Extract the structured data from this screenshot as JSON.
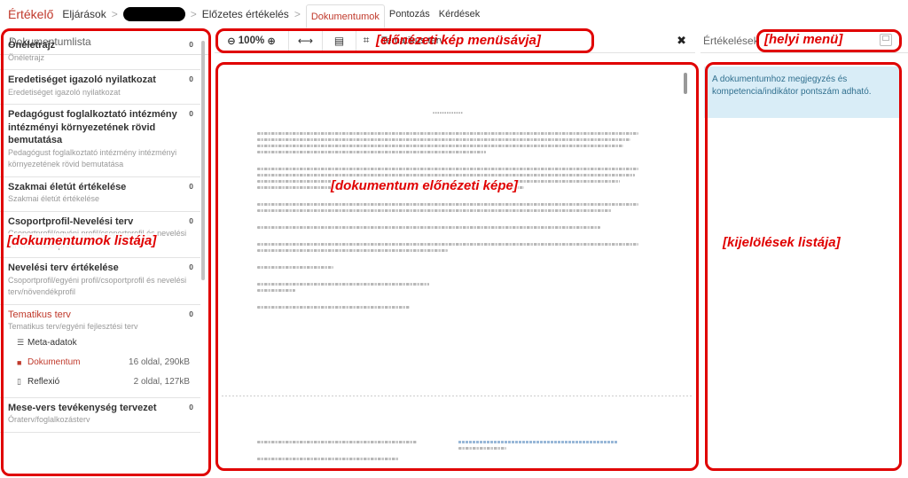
{
  "nav": {
    "brand": "Értékelő",
    "breadcrumb_1": "Eljárások",
    "breadcrumb_3": "Előzetes értékelés",
    "tabs": [
      "Dokumentumok",
      "Pontozás",
      "Kérdések"
    ],
    "active_tab": "Dokumentumok"
  },
  "left": {
    "title": "Dokumentumlista",
    "items": [
      {
        "title": "Önéletrajz",
        "sub": "Önéletrajz",
        "count": "0"
      },
      {
        "title": "Eredetiséget igazoló nyilatkozat",
        "sub": "Eredetiséget igazoló nyilatkozat",
        "count": "0"
      },
      {
        "title": "Pedagógust foglalkoztató intézmény intézményi környezetének rövid bemutatása",
        "sub": "Pedagógust foglalkoztató intézmény intézményi környezetének rövid bemutatása",
        "count": "0"
      },
      {
        "title": "Szakmai életút értékelése",
        "sub": "Szakmai életút értékelése",
        "count": "0"
      },
      {
        "title": "Csoportprofil-Nevelési terv",
        "sub": "Csoportprofil/egyéni profil/csoportprofil és nevelési terv/növendékprofil",
        "count": "0"
      },
      {
        "title": "Nevelési terv értékelése",
        "sub": "Csoportprofil/egyéni profil/csoportprofil és nevelési terv/növendékprofil",
        "count": "0"
      },
      {
        "title": "Tematikus terv",
        "sub": "Tematikus terv/egyéni fejlesztési terv",
        "count": "0"
      },
      {
        "title": "Mese-vers tevékenység tervezet",
        "sub": "Óraterv/foglalkozásterv",
        "count": "0"
      }
    ],
    "subrows": {
      "meta_label": "Meta-adatok",
      "doc_label": "Dokumentum",
      "doc_meta": "16 oldal, 290kB",
      "refl_label": "Reflexió",
      "refl_meta": "2 oldal, 127kB"
    }
  },
  "toolbar": {
    "zoom": "100%",
    "document_name": "Tematikus terv",
    "close": "✖"
  },
  "right": {
    "title": "Értékelések",
    "hint": "A dokumentumhoz megjegyzés és kompetencia/indikátor pontszám adható."
  },
  "annotations": {
    "doclist": "[dokumentumok listája]",
    "preview_toolbar": "[előnézeti kép menüsávja]",
    "local_menu": "[helyi menü]",
    "preview": "[dokumentum előnézeti képe]",
    "marks": "[kijelölések listája]"
  },
  "colors": {
    "brand_red": "#c0392b",
    "annotation_red": "#e00000",
    "hint_bg": "#d9edf7"
  }
}
